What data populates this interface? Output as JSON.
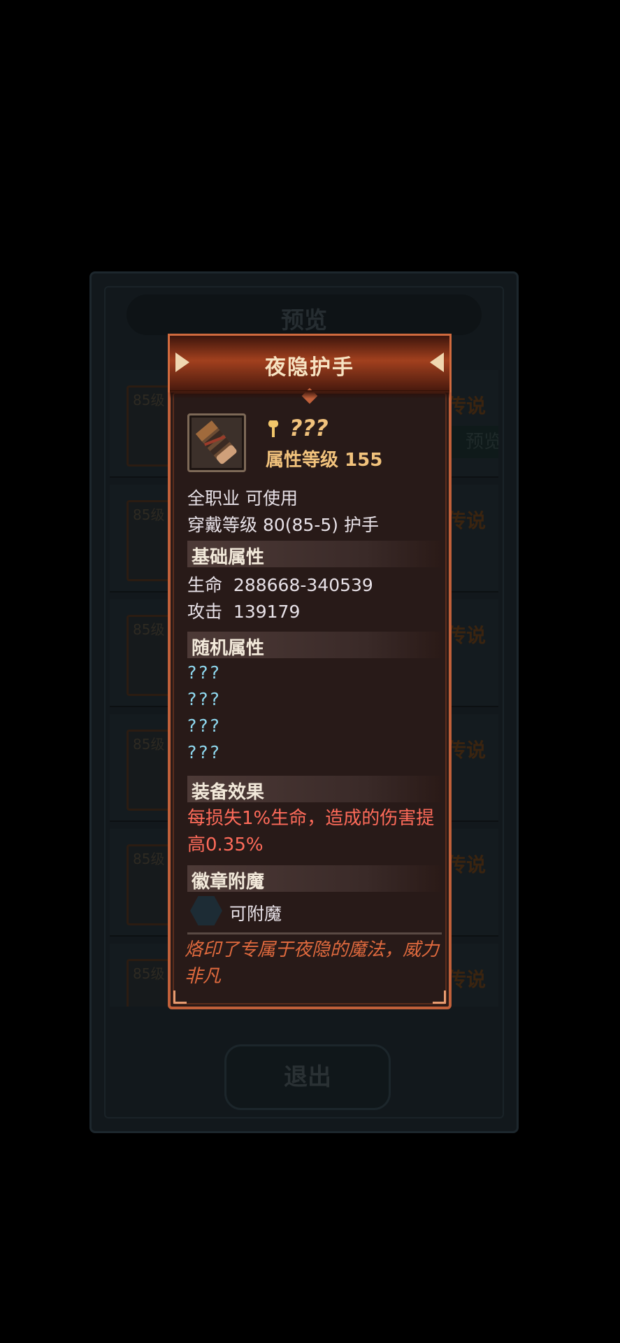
{
  "background": {
    "title": "预览",
    "items": [
      {
        "level": "85级",
        "rarity": "传说"
      },
      {
        "level": "85级",
        "rarity": "传说"
      },
      {
        "level": "85级",
        "rarity": "传说"
      },
      {
        "level": "85级",
        "rarity": "传说"
      },
      {
        "level": "85级",
        "rarity": "传说"
      },
      {
        "level": "85级",
        "rarity": "传说"
      }
    ],
    "preview_button": "预览",
    "exit_button": "退出"
  },
  "item": {
    "title": "夜隐护手",
    "name": "???",
    "attr_level": "属性等级 155",
    "class_req": "全职业 可使用",
    "wear_level": "穿戴等级 80(85-5) 护手",
    "base_section": "基础属性",
    "base_stats": [
      {
        "label": "生命",
        "value": "288668-340539"
      },
      {
        "label": "攻击",
        "value": "139179"
      }
    ],
    "random_section": "随机属性",
    "random_stats": [
      "???",
      "???",
      "???",
      "???"
    ],
    "effect_section": "装备效果",
    "effect_text": "每损失1%生命，造成的伤害提高0.35%",
    "badge_section": "徽章附魔",
    "badge_text": "可附魔",
    "flavor_text": "烙印了专属于夜隐的魔法，威力非凡"
  },
  "colors": {
    "frame": "#c0603a",
    "gold_text": "#f1c27c",
    "effect_red": "#ff6b5a",
    "unknown_cyan": "#8fd9f0",
    "flavor_orange": "#e06a3e"
  },
  "icons": [
    "gauntlet-item-icon",
    "weapon-key-icon",
    "badge-socket-icon",
    "arrow-left-icon",
    "arrow-right-icon"
  ]
}
